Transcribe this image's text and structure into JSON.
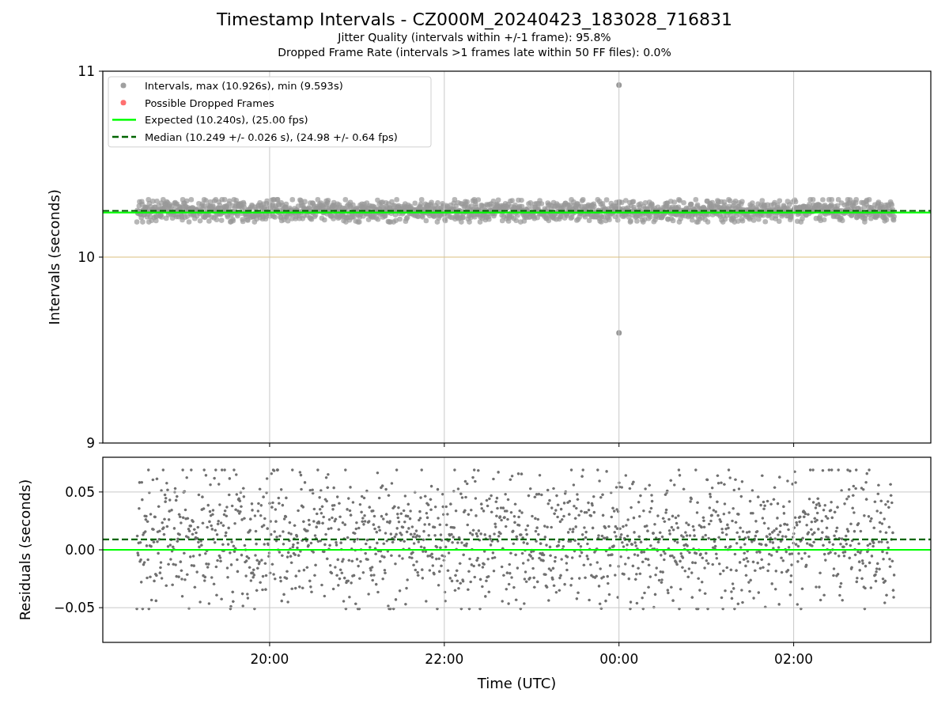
{
  "figure": {
    "title": "Timestamp Intervals - CZ000M_20240423_183028_716831",
    "subtitles": [
      "Jitter Quality (intervals within +/-1 frame): 95.8%",
      "Dropped Frame Rate (intervals >1 frames late within 50 FF files): 0.0%"
    ]
  },
  "charts": [
    {
      "chart_data": {
        "type": "scatter",
        "ylabel": "Intervals (seconds)",
        "categories": [
          null,
          null,
          null,
          null
        ],
        "ylim": [
          9,
          11
        ],
        "grid": true,
        "legend": "upper left",
        "yticks": [
          {
            "value": 9,
            "label": "9"
          },
          {
            "value": 10,
            "label": "10"
          },
          {
            "value": 11,
            "label": "11"
          }
        ],
        "series": [
          {
            "name": "Intervals, max (10.926s), min (9.593s)",
            "color": "#a0a0a0",
            "values": [
              null,
              null,
              null,
              null
            ]
          },
          {
            "name": "Possible Dropped Frames",
            "color": "#ff7070",
            "values": [
              null,
              null,
              null,
              null
            ]
          }
        ],
        "ref_lines": [
          {
            "axis": "y",
            "value": 10.24,
            "label": "Expected (10.240s), (25.00 fps)",
            "color": "#00ff00"
          },
          {
            "axis": "y",
            "value": 10.249,
            "label": "Median (10.249 +/- 0.026 s), (24.98 +/- 0.64 fps)",
            "color": "#006400"
          },
          {
            "axis": "y",
            "value": 10,
            "color": "#dcbf7e"
          }
        ]
      }
    },
    {
      "chart_data": {
        "type": "scatter",
        "xlabel": "Time (UTC)",
        "ylabel": "Residuals (seconds)",
        "ylim": [
          -0.08,
          0.08
        ],
        "grid": true,
        "categories": [
          "20:00",
          "22:00",
          "00:00",
          "02:00"
        ],
        "yticks": [
          {
            "value": -0.05,
            "label": "−0.05"
          },
          {
            "value": 0,
            "label": "0.00"
          },
          {
            "value": 0.05,
            "label": "0.05"
          }
        ],
        "ref_lines": [
          {
            "axis": "y",
            "value": 0,
            "color": "#00ff00"
          },
          {
            "axis": "y",
            "value": 0.009,
            "color": "#006400"
          }
        ]
      }
    }
  ]
}
